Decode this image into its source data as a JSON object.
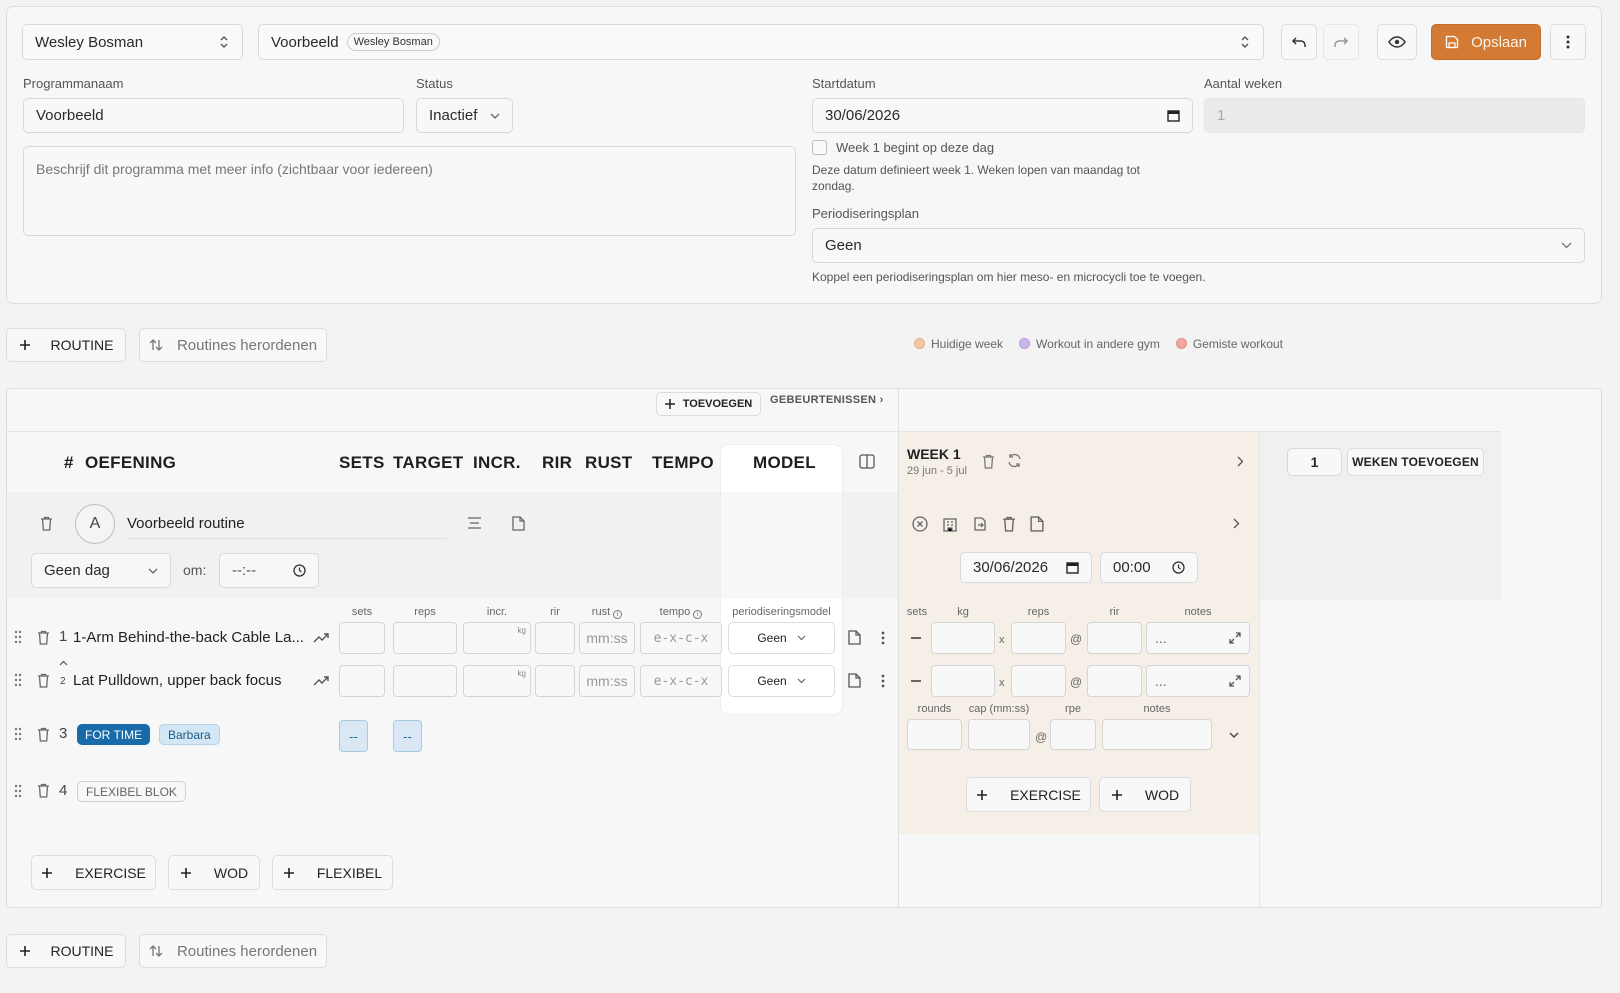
{
  "topbar": {
    "client_select": "Wesley Bosman",
    "program_select": "Voorbeeld",
    "program_badge": "Wesley Bosman",
    "save_label": "Opslaan"
  },
  "form": {
    "program_name_label": "Programmanaam",
    "program_name_value": "Voorbeeld",
    "status_label": "Status",
    "status_value": "Inactief",
    "description_placeholder": "Beschrijf dit programma met meer info (zichtbaar voor iedereen)",
    "startdate_label": "Startdatum",
    "startdate_value": "30/06/2026",
    "weeks_label": "Aantal weken",
    "weeks_value": "1",
    "week1_checkbox": "Week 1 begint op deze dag",
    "date_help": "Deze datum definieert week 1. Weken lopen van maandag tot zondag.",
    "period_label": "Periodiseringsplan",
    "period_value": "Geen",
    "period_help": "Koppel een periodiseringsplan om hier meso- en microcycli toe te voegen."
  },
  "actions": {
    "routine_label": "ROUTINE",
    "reorder_label": "Routines herordenen"
  },
  "legend": [
    {
      "label": "Huidige week",
      "color": "#f2c9a4"
    },
    {
      "label": "Workout in andere gym",
      "color": "#cbb7ec"
    },
    {
      "label": "Gemiste workout",
      "color": "#f1a6a0"
    }
  ],
  "events": {
    "add_label": "TOEVOEGEN",
    "events_label": "GEBEURTENISSEN ›"
  },
  "table": {
    "headers": {
      "hash": "#",
      "exercise": "OEFENING",
      "sets": "SETS",
      "target": "TARGET",
      "incr": "INCR.",
      "rir": "RIR",
      "rust": "RUST",
      "tempo": "TEMPO",
      "model": "MODEL"
    },
    "routine_letter": "A",
    "routine_name": "Voorbeeld routine",
    "day_select": "Geen dag",
    "om_label": "om:",
    "time_placeholder": "--:--",
    "sub": {
      "sets": "sets",
      "reps": "reps",
      "incr": "incr.",
      "rir": "rir",
      "rust": "rust",
      "tempo": "tempo",
      "model": "periodiseringsmodel"
    },
    "kg": "kg",
    "rust_ph": "mm:ss",
    "tempo_ph": "e-x-c-x",
    "rows": [
      {
        "num": "1",
        "name": "1-Arm Behind-the-back Cable La...",
        "model": "Geen"
      },
      {
        "num": "2",
        "name": "Lat Pulldown, upper back focus",
        "model": "Geen"
      }
    ],
    "row3_num": "3",
    "row3_tag1": "FOR TIME",
    "row3_tag2": "Barbara",
    "row3_dash": "--",
    "row4_num": "4",
    "row4_tag": "FLEXIBEL BLOK",
    "add_exercise": "EXERCISE",
    "add_wod": "WOD",
    "add_flex": "FLEXIBEL"
  },
  "week": {
    "title": "WEEK 1",
    "range": "29 jun - 5 jul",
    "date": "30/06/2026",
    "time": "00:00",
    "sub": {
      "sets": "sets",
      "kg": "kg",
      "reps": "reps",
      "rir": "rir",
      "notes": "notes"
    },
    "x": "x",
    "at": "@",
    "notes_ph": "...",
    "wod_sub": {
      "rounds": "rounds",
      "cap": "cap (mm:ss)",
      "rpe": "rpe",
      "notes": "notes"
    },
    "add_exercise": "EXERCISE",
    "add_wod": "WOD"
  },
  "weeks_add": {
    "count": "1",
    "label": "WEKEN TOEVOEGEN"
  }
}
